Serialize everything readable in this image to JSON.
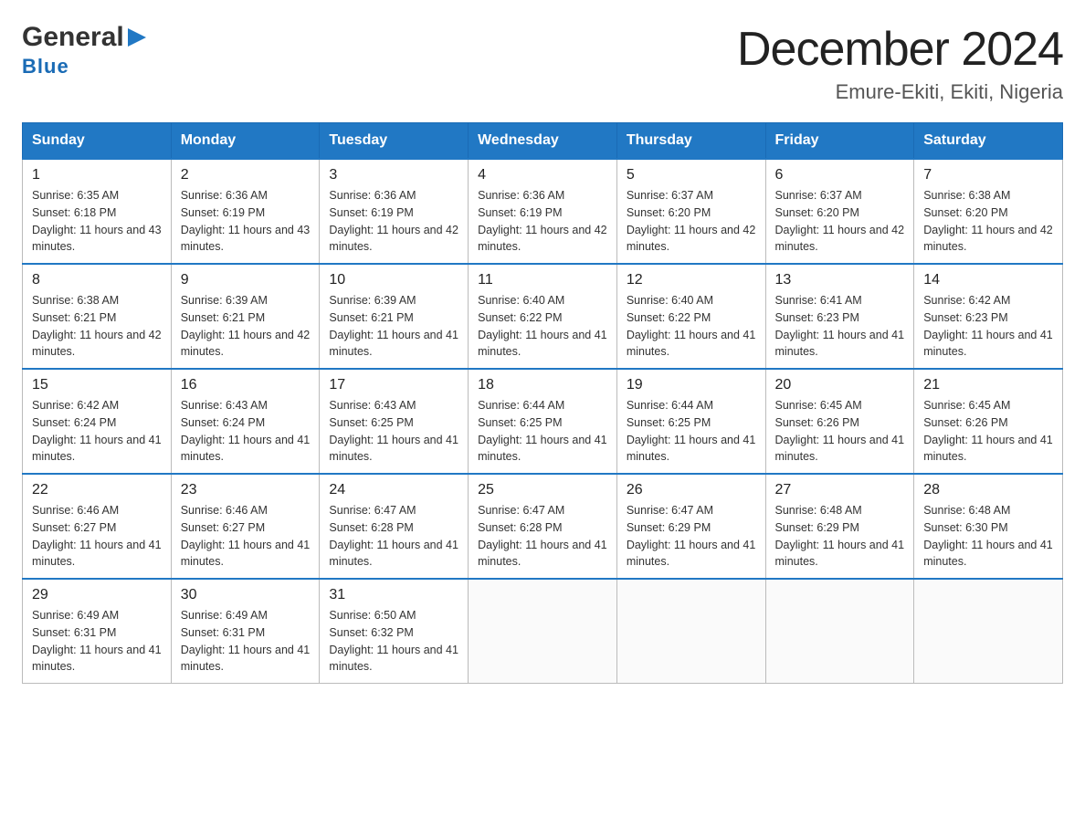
{
  "header": {
    "logo_line1": "General",
    "logo_line2": "Blue",
    "title": "December 2024",
    "subtitle": "Emure-Ekiti, Ekiti, Nigeria"
  },
  "weekdays": [
    "Sunday",
    "Monday",
    "Tuesday",
    "Wednesday",
    "Thursday",
    "Friday",
    "Saturday"
  ],
  "weeks": [
    [
      {
        "day": "1",
        "sunrise": "Sunrise: 6:35 AM",
        "sunset": "Sunset: 6:18 PM",
        "daylight": "Daylight: 11 hours and 43 minutes."
      },
      {
        "day": "2",
        "sunrise": "Sunrise: 6:36 AM",
        "sunset": "Sunset: 6:19 PM",
        "daylight": "Daylight: 11 hours and 43 minutes."
      },
      {
        "day": "3",
        "sunrise": "Sunrise: 6:36 AM",
        "sunset": "Sunset: 6:19 PM",
        "daylight": "Daylight: 11 hours and 42 minutes."
      },
      {
        "day": "4",
        "sunrise": "Sunrise: 6:36 AM",
        "sunset": "Sunset: 6:19 PM",
        "daylight": "Daylight: 11 hours and 42 minutes."
      },
      {
        "day": "5",
        "sunrise": "Sunrise: 6:37 AM",
        "sunset": "Sunset: 6:20 PM",
        "daylight": "Daylight: 11 hours and 42 minutes."
      },
      {
        "day": "6",
        "sunrise": "Sunrise: 6:37 AM",
        "sunset": "Sunset: 6:20 PM",
        "daylight": "Daylight: 11 hours and 42 minutes."
      },
      {
        "day": "7",
        "sunrise": "Sunrise: 6:38 AM",
        "sunset": "Sunset: 6:20 PM",
        "daylight": "Daylight: 11 hours and 42 minutes."
      }
    ],
    [
      {
        "day": "8",
        "sunrise": "Sunrise: 6:38 AM",
        "sunset": "Sunset: 6:21 PM",
        "daylight": "Daylight: 11 hours and 42 minutes."
      },
      {
        "day": "9",
        "sunrise": "Sunrise: 6:39 AM",
        "sunset": "Sunset: 6:21 PM",
        "daylight": "Daylight: 11 hours and 42 minutes."
      },
      {
        "day": "10",
        "sunrise": "Sunrise: 6:39 AM",
        "sunset": "Sunset: 6:21 PM",
        "daylight": "Daylight: 11 hours and 41 minutes."
      },
      {
        "day": "11",
        "sunrise": "Sunrise: 6:40 AM",
        "sunset": "Sunset: 6:22 PM",
        "daylight": "Daylight: 11 hours and 41 minutes."
      },
      {
        "day": "12",
        "sunrise": "Sunrise: 6:40 AM",
        "sunset": "Sunset: 6:22 PM",
        "daylight": "Daylight: 11 hours and 41 minutes."
      },
      {
        "day": "13",
        "sunrise": "Sunrise: 6:41 AM",
        "sunset": "Sunset: 6:23 PM",
        "daylight": "Daylight: 11 hours and 41 minutes."
      },
      {
        "day": "14",
        "sunrise": "Sunrise: 6:42 AM",
        "sunset": "Sunset: 6:23 PM",
        "daylight": "Daylight: 11 hours and 41 minutes."
      }
    ],
    [
      {
        "day": "15",
        "sunrise": "Sunrise: 6:42 AM",
        "sunset": "Sunset: 6:24 PM",
        "daylight": "Daylight: 11 hours and 41 minutes."
      },
      {
        "day": "16",
        "sunrise": "Sunrise: 6:43 AM",
        "sunset": "Sunset: 6:24 PM",
        "daylight": "Daylight: 11 hours and 41 minutes."
      },
      {
        "day": "17",
        "sunrise": "Sunrise: 6:43 AM",
        "sunset": "Sunset: 6:25 PM",
        "daylight": "Daylight: 11 hours and 41 minutes."
      },
      {
        "day": "18",
        "sunrise": "Sunrise: 6:44 AM",
        "sunset": "Sunset: 6:25 PM",
        "daylight": "Daylight: 11 hours and 41 minutes."
      },
      {
        "day": "19",
        "sunrise": "Sunrise: 6:44 AM",
        "sunset": "Sunset: 6:25 PM",
        "daylight": "Daylight: 11 hours and 41 minutes."
      },
      {
        "day": "20",
        "sunrise": "Sunrise: 6:45 AM",
        "sunset": "Sunset: 6:26 PM",
        "daylight": "Daylight: 11 hours and 41 minutes."
      },
      {
        "day": "21",
        "sunrise": "Sunrise: 6:45 AM",
        "sunset": "Sunset: 6:26 PM",
        "daylight": "Daylight: 11 hours and 41 minutes."
      }
    ],
    [
      {
        "day": "22",
        "sunrise": "Sunrise: 6:46 AM",
        "sunset": "Sunset: 6:27 PM",
        "daylight": "Daylight: 11 hours and 41 minutes."
      },
      {
        "day": "23",
        "sunrise": "Sunrise: 6:46 AM",
        "sunset": "Sunset: 6:27 PM",
        "daylight": "Daylight: 11 hours and 41 minutes."
      },
      {
        "day": "24",
        "sunrise": "Sunrise: 6:47 AM",
        "sunset": "Sunset: 6:28 PM",
        "daylight": "Daylight: 11 hours and 41 minutes."
      },
      {
        "day": "25",
        "sunrise": "Sunrise: 6:47 AM",
        "sunset": "Sunset: 6:28 PM",
        "daylight": "Daylight: 11 hours and 41 minutes."
      },
      {
        "day": "26",
        "sunrise": "Sunrise: 6:47 AM",
        "sunset": "Sunset: 6:29 PM",
        "daylight": "Daylight: 11 hours and 41 minutes."
      },
      {
        "day": "27",
        "sunrise": "Sunrise: 6:48 AM",
        "sunset": "Sunset: 6:29 PM",
        "daylight": "Daylight: 11 hours and 41 minutes."
      },
      {
        "day": "28",
        "sunrise": "Sunrise: 6:48 AM",
        "sunset": "Sunset: 6:30 PM",
        "daylight": "Daylight: 11 hours and 41 minutes."
      }
    ],
    [
      {
        "day": "29",
        "sunrise": "Sunrise: 6:49 AM",
        "sunset": "Sunset: 6:31 PM",
        "daylight": "Daylight: 11 hours and 41 minutes."
      },
      {
        "day": "30",
        "sunrise": "Sunrise: 6:49 AM",
        "sunset": "Sunset: 6:31 PM",
        "daylight": "Daylight: 11 hours and 41 minutes."
      },
      {
        "day": "31",
        "sunrise": "Sunrise: 6:50 AM",
        "sunset": "Sunset: 6:32 PM",
        "daylight": "Daylight: 11 hours and 41 minutes."
      },
      null,
      null,
      null,
      null
    ]
  ]
}
